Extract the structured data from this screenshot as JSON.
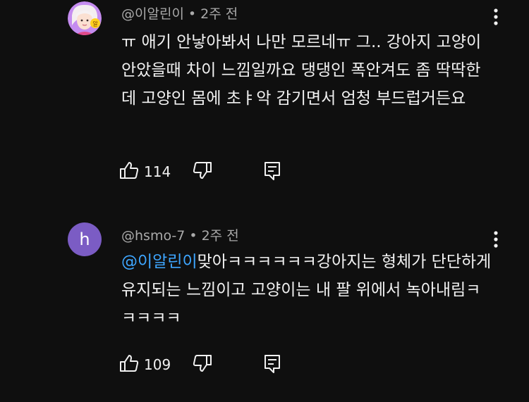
{
  "comments": [
    {
      "author": "@이알린이",
      "age": "2주 전",
      "text": "ㅠ 애기 안낳아봐서 나만 모르네ㅠ 그.. 강아지 고양이 안았을때 차이 느낌일까요 댕댕인 폭안겨도 좀 딱딱한데 고양인 몸에 초ㅑ악 감기면서 엄청 부드럽거든요",
      "likes": "114"
    },
    {
      "author": "@hsmo-7",
      "avatar_letter": "h",
      "age": "2주 전",
      "mention": "@이알린이",
      "text": "맞아ㅋㅋㅋㅋㅋㅋ강아지는 형체가 단단하게 유지되는 느낌이고 고양이는 내 팔 위에서 녹아내림ㅋㅋㅋㅋㅋ",
      "likes": "109"
    }
  ],
  "separator": "•",
  "colors": {
    "background": "#0f0f0f",
    "text": "#f1f1f1",
    "meta": "#aaaaaa",
    "mention": "#3ea6ff",
    "avatar_h": "#7b5cc4"
  },
  "icons": [
    "kebab-menu-icon",
    "thumbs-up-icon",
    "thumbs-down-icon",
    "reply-comment-icon"
  ]
}
